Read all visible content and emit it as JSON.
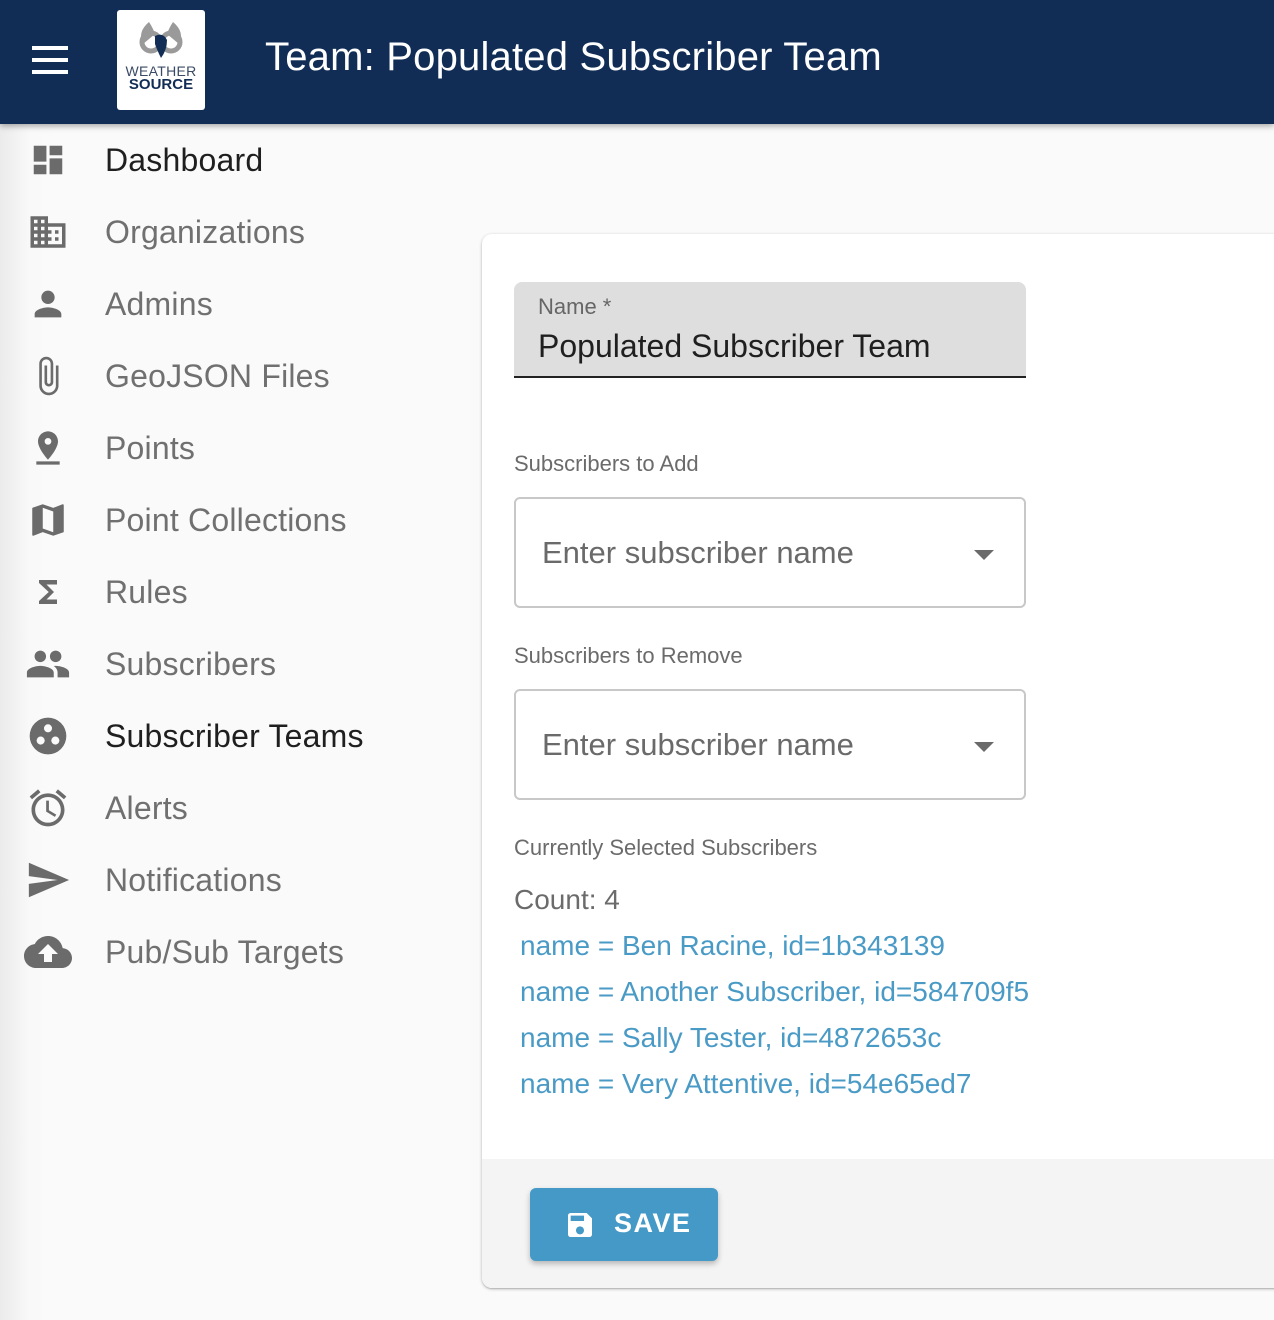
{
  "appbar": {
    "title": "Team: Populated Subscriber Team",
    "logo": {
      "line1": "WEATHER",
      "line2": "SOURCE"
    },
    "menu_icon": "hamburger-menu-icon"
  },
  "sidebar": {
    "items": [
      {
        "label": "Dashboard",
        "icon": "dashboard-icon",
        "active": false
      },
      {
        "label": "Organizations",
        "icon": "building-icon",
        "active": false
      },
      {
        "label": "Admins",
        "icon": "person-icon",
        "active": false
      },
      {
        "label": "GeoJSON Files",
        "icon": "paperclip-icon",
        "active": false
      },
      {
        "label": "Points",
        "icon": "pin-drop-icon",
        "active": false
      },
      {
        "label": "Point Collections",
        "icon": "map-icon",
        "active": false
      },
      {
        "label": "Rules",
        "icon": "sigma-icon",
        "active": false
      },
      {
        "label": "Subscribers",
        "icon": "people-icon",
        "active": false
      },
      {
        "label": "Subscriber Teams",
        "icon": "workspaces-icon",
        "active": true
      },
      {
        "label": "Alerts",
        "icon": "alarm-clock-icon",
        "active": false
      },
      {
        "label": "Notifications",
        "icon": "send-icon",
        "active": false
      },
      {
        "label": "Pub/Sub Targets",
        "icon": "cloud-upload-icon",
        "active": false
      }
    ]
  },
  "form": {
    "name_label": "Name *",
    "name_value": "Populated Subscriber Team",
    "add_label": "Subscribers to Add",
    "add_placeholder": "Enter subscriber name",
    "remove_label": "Subscribers to Remove",
    "remove_placeholder": "Enter subscriber name",
    "selected_label": "Currently Selected Subscribers",
    "count_text": "Count: 4",
    "subscribers": [
      "name = Ben Racine, id=1b343139",
      "name = Another Subscriber, id=584709f5",
      "name = Sally Tester, id=4872653c",
      "name = Very Attentive, id=54e65ed7"
    ],
    "save_label": "SAVE"
  },
  "colors": {
    "appbar": "#112d55",
    "accent": "#4599c6",
    "link": "#4a9ac6"
  }
}
